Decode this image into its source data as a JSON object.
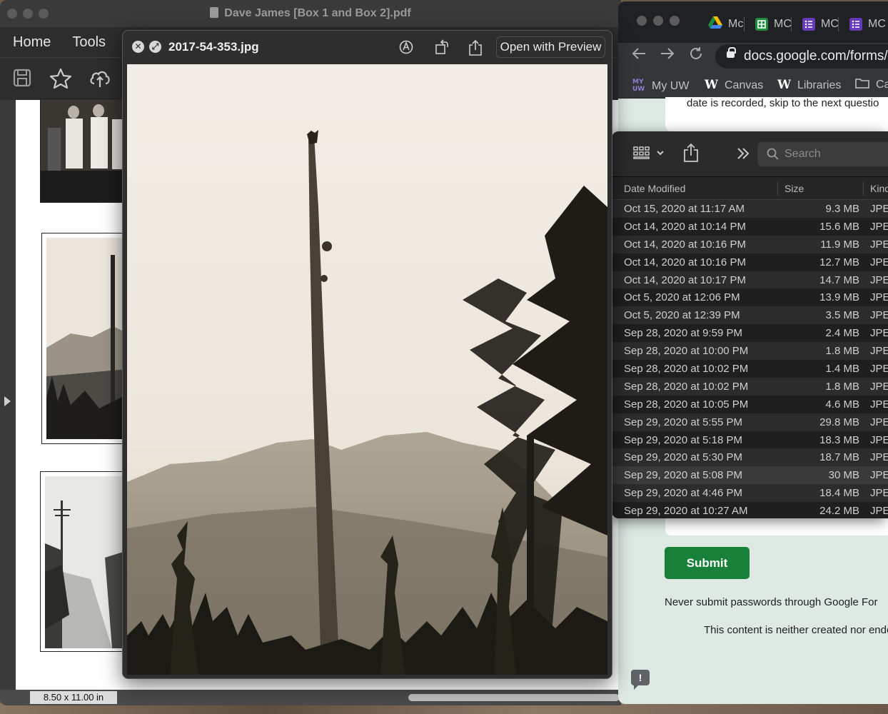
{
  "pdf_window": {
    "title": "Dave James [Box 1 and Box 2].pdf",
    "menu": [
      "Home",
      "Tools"
    ],
    "toolbar_icons": [
      "save-icon",
      "star-icon",
      "cloud-upload-icon"
    ],
    "page_size": "8.50 x 11.00 in"
  },
  "quicklook": {
    "filename": "2017-54-353.jpg",
    "open_button": "Open with Preview",
    "tools": [
      "markup-icon",
      "rotate-icon",
      "share-icon"
    ]
  },
  "chrome": {
    "tabs": [
      {
        "label": "Mc",
        "icon": "google-drive-icon"
      },
      {
        "label": "MC",
        "icon": "google-sheets-icon"
      },
      {
        "label": "MC",
        "icon": "google-forms-icon"
      },
      {
        "label": "MC",
        "icon": "google-forms-icon"
      }
    ],
    "url": "docs.google.com/forms/",
    "bookmarks": [
      {
        "label": "My UW",
        "icon": "my-uw-icon"
      },
      {
        "label": "Canvas",
        "icon": "uw-w-icon"
      },
      {
        "label": "Libraries",
        "icon": "uw-w-icon"
      },
      {
        "label": "Ca",
        "icon": "folder-icon"
      }
    ],
    "form": {
      "question_text": "date is recorded, skip to the next questio",
      "submit_label": "Submit",
      "password_warning": "Never submit passwords through Google For",
      "notice": "This content is neither created nor endo"
    }
  },
  "finder": {
    "search_placeholder": "Search",
    "columns": [
      "Date Modified",
      "Size",
      "Kind"
    ],
    "rows": [
      {
        "date": "Oct 15, 2020 at 11:17 AM",
        "size": "9.3 MB",
        "kind": "JPE"
      },
      {
        "date": "Oct 14, 2020 at 10:14 PM",
        "size": "15.6 MB",
        "kind": "JPE"
      },
      {
        "date": "Oct 14, 2020 at 10:16 PM",
        "size": "11.9 MB",
        "kind": "JPE"
      },
      {
        "date": "Oct 14, 2020 at 10:16 PM",
        "size": "12.7 MB",
        "kind": "JPE"
      },
      {
        "date": "Oct 14, 2020 at 10:17 PM",
        "size": "14.7 MB",
        "kind": "JPE"
      },
      {
        "date": "Oct 5, 2020 at 12:06 PM",
        "size": "13.9 MB",
        "kind": "JPE"
      },
      {
        "date": "Oct 5, 2020 at 12:39 PM",
        "size": "3.5 MB",
        "kind": "JPE"
      },
      {
        "date": "Sep 28, 2020 at 9:59 PM",
        "size": "2.4 MB",
        "kind": "JPE"
      },
      {
        "date": "Sep 28, 2020 at 10:00 PM",
        "size": "1.8 MB",
        "kind": "JPE"
      },
      {
        "date": "Sep 28, 2020 at 10:02 PM",
        "size": "1.4 MB",
        "kind": "JPE"
      },
      {
        "date": "Sep 28, 2020 at 10:02 PM",
        "size": "1.8 MB",
        "kind": "JPE"
      },
      {
        "date": "Sep 28, 2020 at 10:05 PM",
        "size": "4.6 MB",
        "kind": "JPE"
      },
      {
        "date": "Sep 29, 2020 at 5:55 PM",
        "size": "29.8 MB",
        "kind": "JPE"
      },
      {
        "date": "Sep 29, 2020 at 5:18 PM",
        "size": "18.3 MB",
        "kind": "JPE"
      },
      {
        "date": "Sep 29, 2020 at 5:30 PM",
        "size": "18.7 MB",
        "kind": "JPE"
      },
      {
        "date": "Sep 29, 2020 at 5:08 PM",
        "size": "30 MB",
        "kind": "JPE"
      },
      {
        "date": "Sep 29, 2020 at 4:46 PM",
        "size": "18.4 MB",
        "kind": "JPE"
      },
      {
        "date": "Sep 29, 2020 at 10:27 AM",
        "size": "24.2 MB",
        "kind": "JPE"
      }
    ],
    "highlighted_row": 15
  },
  "colors": {
    "submit_green": "#188038",
    "form_background": "#dde9e2",
    "photo_sepia": "#f0ece4"
  }
}
